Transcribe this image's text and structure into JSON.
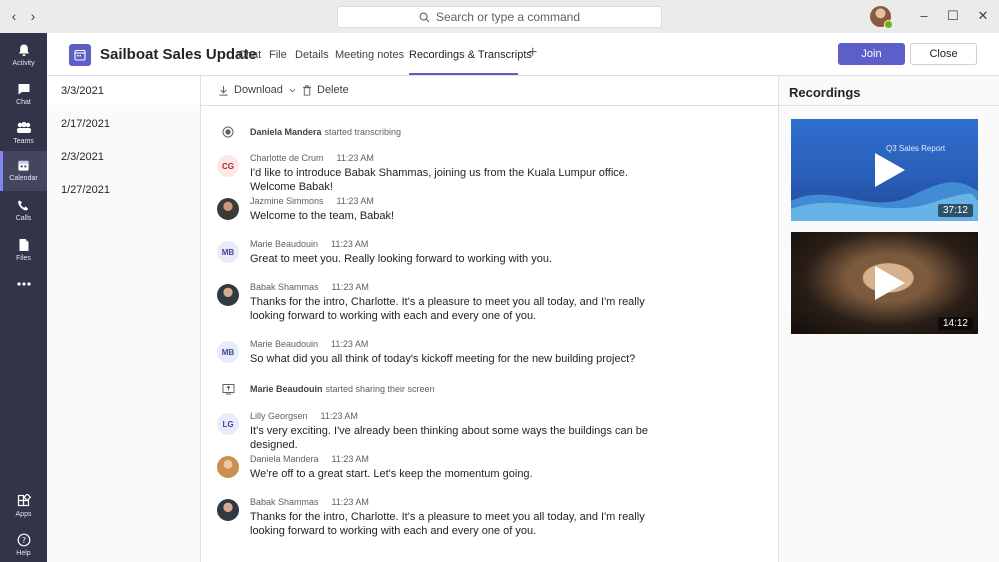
{
  "titlebar": {
    "search_placeholder": "Search or type a command"
  },
  "rail": {
    "items": [
      {
        "label": "Activity",
        "icon": "bell-icon"
      },
      {
        "label": "Chat",
        "icon": "chat-icon"
      },
      {
        "label": "Teams",
        "icon": "teams-icon"
      },
      {
        "label": "Calendar",
        "icon": "calendar-icon"
      },
      {
        "label": "Calls",
        "icon": "phone-icon"
      },
      {
        "label": "Files",
        "icon": "file-icon"
      },
      {
        "label": "",
        "icon": "more-icon"
      },
      {
        "label": "Apps",
        "icon": "apps-icon"
      },
      {
        "label": "Help",
        "icon": "help-icon"
      }
    ],
    "active": "Calendar"
  },
  "header": {
    "title": "Sailboat Sales Update",
    "tabs": [
      "Chat",
      "File",
      "Details",
      "Meeting notes",
      "Recordings & Transcripts"
    ],
    "active_tab": "Recordings & Transcripts",
    "join_label": "Join",
    "close_label": "Close"
  },
  "dates": [
    "3/3/2021",
    "2/17/2021",
    "2/3/2021",
    "1/27/2021"
  ],
  "toolbar": {
    "download_label": "Download",
    "delete_label": "Delete"
  },
  "transcript": {
    "event1": {
      "name": "Daniela Mandera",
      "action": "started transcribing"
    },
    "m1": {
      "initials": "CG",
      "name": "Charlotte de Crum",
      "time": "11:23 AM",
      "text": "I'd like to introduce Babak Shammas, joining us from the Kuala Lumpur office. Welcome Babak!"
    },
    "m2": {
      "name": "Jazmine Simmons",
      "time": "11:23 AM",
      "text": "Welcome to the team, Babak!"
    },
    "m3": {
      "initials": "MB",
      "name": "Marie Beaudouin",
      "time": "11:23 AM",
      "text": "Great to meet you. Really looking forward to working with you."
    },
    "m4": {
      "name": "Babak Shammas",
      "time": "11:23 AM",
      "text": "Thanks for the intro, Charlotte. It's a pleasure to meet you all today, and I'm really looking forward to working with each and every one of you."
    },
    "m5": {
      "initials": "MB",
      "name": "Marie Beaudouin",
      "time": "11:23 AM",
      "text": "So what did you all think of today's kickoff meeting for the new building project?"
    },
    "event2": {
      "name": "Marie Beaudouin",
      "action": "started sharing their screen"
    },
    "m6": {
      "initials": "LG",
      "name": "Lilly Georgsen",
      "time": "11:23 AM",
      "text": "It's very exciting. I've already been thinking about some ways the buildings can be designed."
    },
    "m7": {
      "name": "Daniela Mandera",
      "time": "11:23 AM",
      "text": "We're off to a great start. Let's keep the momentum going."
    },
    "m8": {
      "name": "Babak Shammas",
      "time": "11:23 AM",
      "text": "Thanks for the intro, Charlotte. It's a pleasure to meet you all today, and I'm really looking forward to working with each and every one of you."
    }
  },
  "recordings": {
    "title": "Recordings",
    "items": [
      {
        "slide_title": "Q3 Sales Report",
        "duration": "37:12"
      },
      {
        "duration": "14:12"
      }
    ]
  },
  "colors": {
    "rail_bg": "#33344a",
    "accent": "#5b5fc7",
    "titlebar_bg": "#ebebeb"
  }
}
